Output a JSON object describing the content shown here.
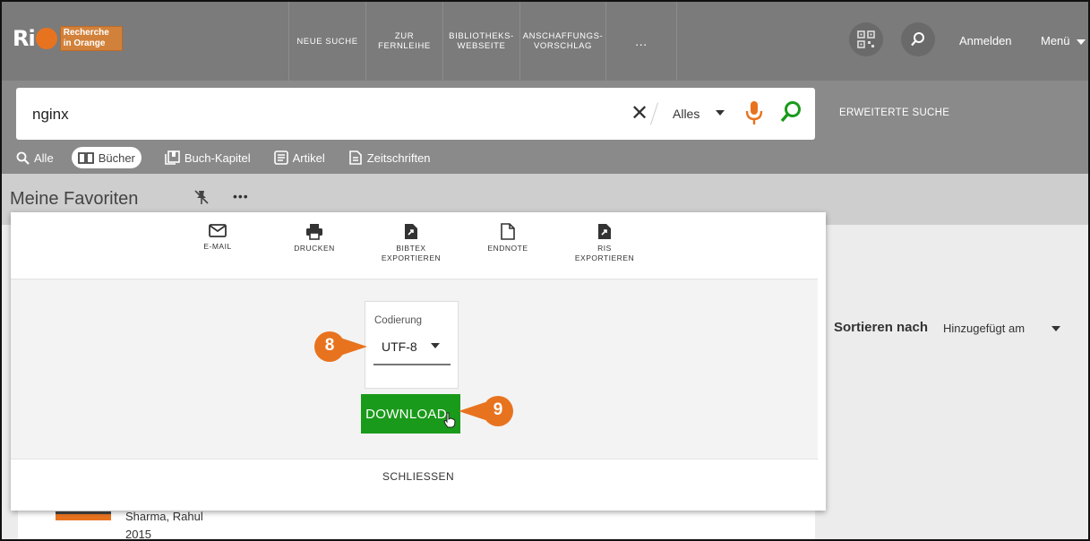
{
  "brand": {
    "logo_text": "Ri",
    "tagline_line1": "Recherche",
    "tagline_line2": "in Orange"
  },
  "nav": [
    {
      "label": "NEUE SUCHE"
    },
    {
      "label": "ZUR\nFERNLEIHE"
    },
    {
      "label": "BIBLIOTHEKS-\nWEBSEITE"
    },
    {
      "label": "ANSCHAFFUNGS-\nVORSCHLAG"
    },
    {
      "label": "..."
    }
  ],
  "header_right": {
    "login": "Anmelden",
    "menu": "Menü"
  },
  "search": {
    "value": "nginx",
    "scope": "Alles",
    "advanced": "ERWEITERTE SUCHE"
  },
  "tabs": [
    {
      "label": "Alle"
    },
    {
      "label": "Bücher"
    },
    {
      "label": "Buch-Kapitel"
    },
    {
      "label": "Artikel"
    },
    {
      "label": "Zeitschriften"
    }
  ],
  "favorites": {
    "title": "Meine Favoriten",
    "more": "•••"
  },
  "actions": {
    "email": "E-MAIL",
    "print": "DRUCKEN",
    "bibtex_line1": "BIBTEX",
    "bibtex_line2": "EXPORTIEREN",
    "endnote": "ENDNOTE",
    "ris_line1": "RIS",
    "ris_line2": "EXPORTIEREN"
  },
  "export": {
    "encoding_label": "Codierung",
    "encoding_value": "UTF-8",
    "download": "DOWNLOAD",
    "close": "SCHLIESSEN"
  },
  "sort": {
    "label": "Sortieren nach",
    "value": "Hinzugefügt am"
  },
  "callouts": {
    "first": "8",
    "second": "9"
  },
  "list": {
    "author": "Sharma, Rahul",
    "year": "2015"
  },
  "colors": {
    "accent": "#e8731f",
    "download": "#1a9a1a",
    "topbar": "#7b7b7b"
  }
}
